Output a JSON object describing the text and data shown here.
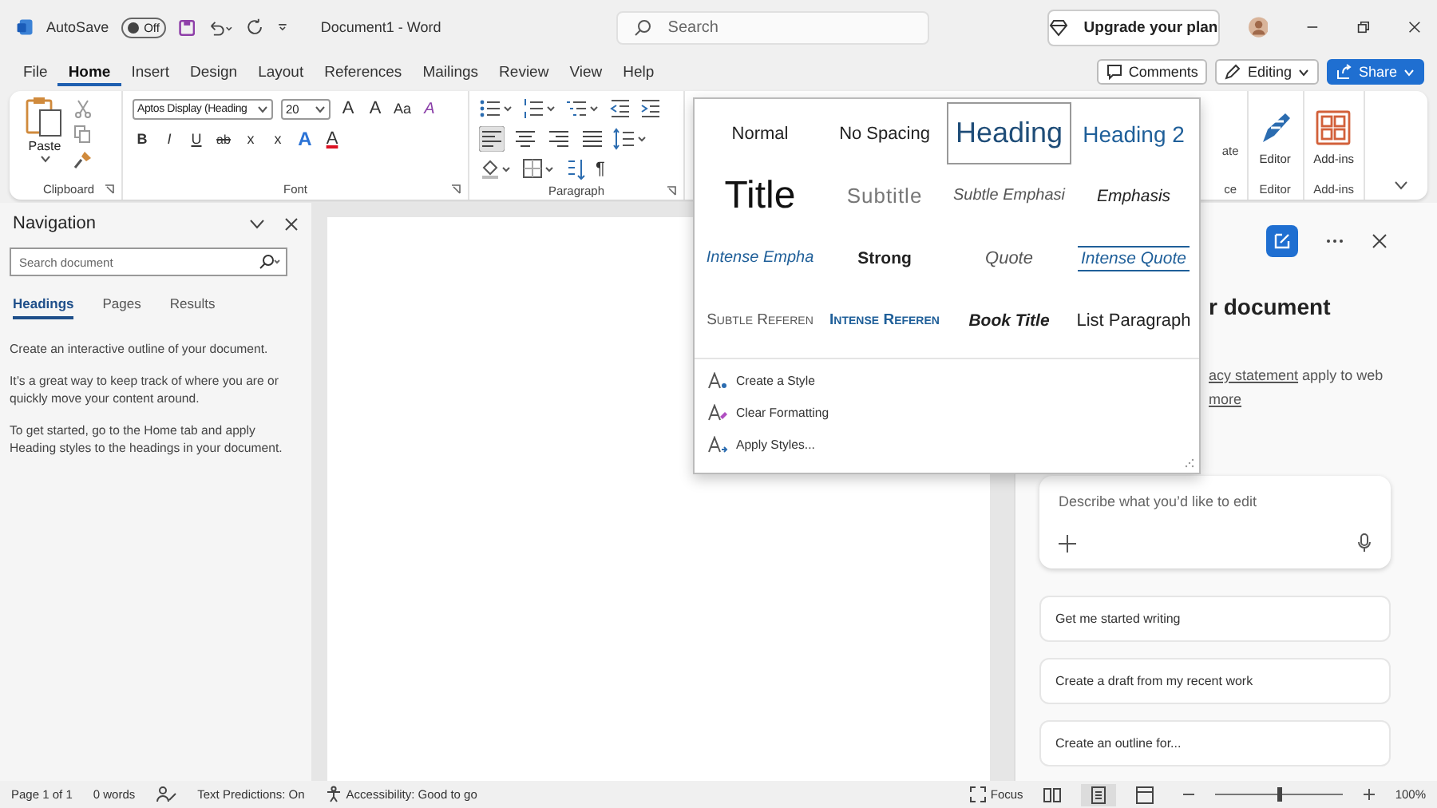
{
  "title_bar": {
    "autosave_label": "AutoSave",
    "autosave_toggle": {
      "label": "Off",
      "on": false
    },
    "document_title": "Document1  -  Word",
    "search": {
      "placeholder": "Search"
    },
    "upgrade_button": "Upgrade your plan"
  },
  "menu_tabs": [
    {
      "label": "File",
      "selected": false
    },
    {
      "label": "Home",
      "selected": true
    },
    {
      "label": "Insert",
      "selected": false
    },
    {
      "label": "Design",
      "selected": false
    },
    {
      "label": "Layout",
      "selected": false
    },
    {
      "label": "References",
      "selected": false
    },
    {
      "label": "Mailings",
      "selected": false
    },
    {
      "label": "Review",
      "selected": false
    },
    {
      "label": "View",
      "selected": false
    },
    {
      "label": "Help",
      "selected": false
    }
  ],
  "header_buttons": {
    "comments": "Comments",
    "editing": "Editing",
    "share": "Share"
  },
  "ribbon": {
    "clipboard": {
      "paste": "Paste",
      "label": "Clipboard"
    },
    "font": {
      "font_name": "Aptos Display (Heading",
      "font_size": "20",
      "label": "Font",
      "top_buttons": [
        {
          "label": "A",
          "kind": "grow"
        },
        {
          "label": "A",
          "kind": "shrink"
        },
        {
          "label": "Aa",
          "kind": "case"
        },
        {
          "label": "A",
          "kind": "clear"
        }
      ],
      "bottom_buttons": [
        {
          "label": "B",
          "kind": "bold"
        },
        {
          "label": "I",
          "kind": "italic"
        },
        {
          "label": "U",
          "kind": "underline"
        },
        {
          "label": "ab",
          "kind": "strike"
        },
        {
          "label": "x",
          "kind": "sub"
        },
        {
          "label": "x",
          "kind": "sup"
        },
        {
          "label": "A",
          "kind": "effects"
        },
        {
          "label": "A",
          "kind": "color"
        }
      ]
    },
    "paragraph": {
      "label": "Paragraph",
      "pilcrow": "¶",
      "align": [
        {
          "kind": "left",
          "selected": true
        },
        {
          "kind": "center",
          "selected": false
        },
        {
          "kind": "right",
          "selected": false
        },
        {
          "kind": "justify",
          "selected": false
        }
      ]
    },
    "partial": {
      "button": "ate",
      "label": "ce"
    },
    "editor": {
      "button": "Editor",
      "label": "Editor"
    },
    "addins": {
      "button": "Add-ins",
      "label": "Add-ins"
    }
  },
  "navigation": {
    "title": "Navigation",
    "search": {
      "placeholder": "Search document"
    },
    "tabs": [
      {
        "label": "Headings",
        "selected": true
      },
      {
        "label": "Pages",
        "selected": false
      },
      {
        "label": "Results",
        "selected": false
      }
    ],
    "paragraphs": [
      "Create an interactive outline of your document.",
      "It’s a great way to keep track of where you are or quickly move your content around.",
      "To get started, go to the Home tab and apply Heading styles to the headings in your document."
    ]
  },
  "styles_gallery": {
    "styles": [
      {
        "label": "Normal",
        "kind": "normal",
        "selected": false
      },
      {
        "label": "No Spacing",
        "kind": "no-spacing",
        "selected": false
      },
      {
        "label": "Heading",
        "kind": "heading1",
        "selected": true
      },
      {
        "label": "Heading 2",
        "kind": "heading2",
        "selected": false
      },
      {
        "label": "Title",
        "kind": "title",
        "selected": false
      },
      {
        "label": "Subtitle",
        "kind": "subtitle",
        "selected": false
      },
      {
        "label": "Subtle Emphasi",
        "kind": "subtle-emphasis",
        "selected": false
      },
      {
        "label": "Emphasis",
        "kind": "emphasis",
        "selected": false
      },
      {
        "label": "Intense Empha",
        "kind": "intense-emphasis",
        "selected": false
      },
      {
        "label": "Strong",
        "kind": "strong",
        "selected": false
      },
      {
        "label": "Quote",
        "kind": "quote",
        "selected": false
      },
      {
        "label": "Intense Quote",
        "kind": "intense-quote",
        "selected": false
      },
      {
        "label": "Subtle Referen",
        "kind": "subtle-reference",
        "selected": false
      },
      {
        "label": "Intense Referen",
        "kind": "intense-reference",
        "selected": false
      },
      {
        "label": "Book Title",
        "kind": "book-title",
        "selected": false
      },
      {
        "label": "List Paragraph",
        "kind": "list-paragraph",
        "selected": false
      }
    ],
    "actions": [
      {
        "label": "Create a Style",
        "kind": "create"
      },
      {
        "label": "Clear Formatting",
        "kind": "clear"
      },
      {
        "label": "Apply Styles...",
        "kind": "apply"
      }
    ]
  },
  "copilot": {
    "heading_fragment": "r document",
    "link_fragment": "acy statement",
    "text_fragment": "apply to web",
    "more_fragment": "more",
    "prompt": {
      "placeholder": "Describe what you’d like to edit"
    },
    "suggestions": [
      "Get me started writing",
      "Create a draft from my recent work",
      "Create an outline for..."
    ]
  },
  "status_bar": {
    "page": "Page 1 of 1",
    "words": "0 words",
    "text_predictions": "Text Predictions: On",
    "accessibility": "Accessibility: Good to go",
    "focus": "Focus",
    "views": [
      {
        "kind": "read",
        "selected": false
      },
      {
        "kind": "print",
        "selected": true
      },
      {
        "kind": "web",
        "selected": false
      }
    ],
    "zoom": {
      "level": 0.5,
      "label": "100%"
    }
  }
}
